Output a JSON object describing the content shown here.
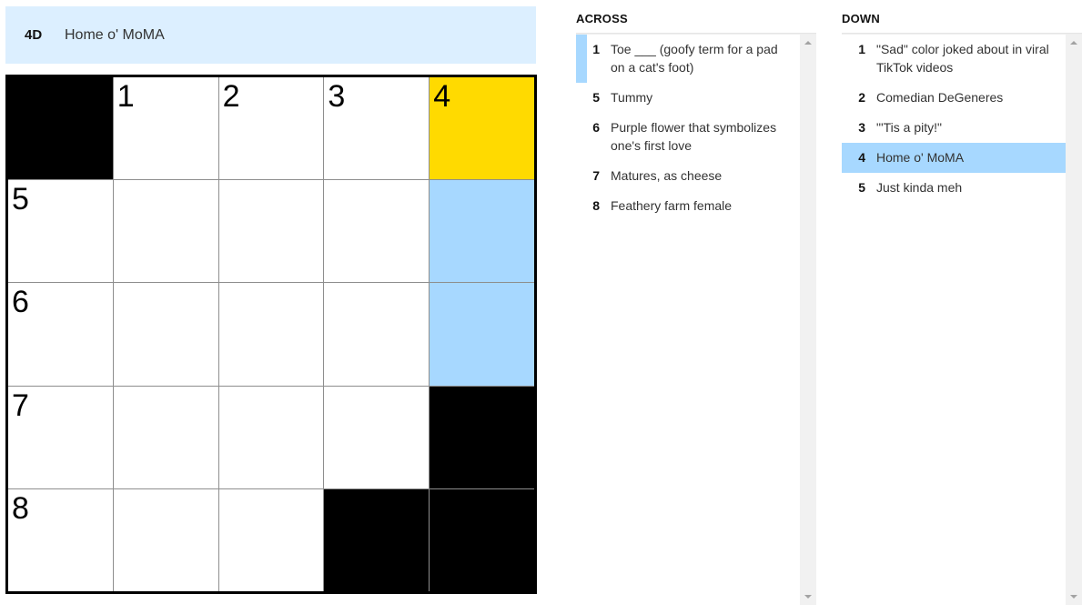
{
  "current_clue": {
    "label": "4D",
    "text": "Home o' MoMA"
  },
  "board": {
    "rows": [
      [
        {
          "type": "block"
        },
        {
          "num": "1"
        },
        {
          "num": "2"
        },
        {
          "num": "3"
        },
        {
          "num": "4",
          "state": "selected"
        }
      ],
      [
        {
          "num": "5"
        },
        {},
        {},
        {},
        {
          "state": "highlight"
        }
      ],
      [
        {
          "num": "6"
        },
        {},
        {},
        {},
        {
          "state": "highlight"
        }
      ],
      [
        {
          "num": "7"
        },
        {},
        {},
        {},
        {
          "type": "block"
        }
      ],
      [
        {
          "num": "8"
        },
        {},
        {},
        {
          "type": "block"
        },
        {
          "type": "block"
        }
      ]
    ]
  },
  "across": {
    "title": "ACROSS",
    "items": [
      {
        "num": "1",
        "text": "Toe ___ (goofy term for a pad on a cat's foot)",
        "state": "cross-active"
      },
      {
        "num": "5",
        "text": "Tummy"
      },
      {
        "num": "6",
        "text": "Purple flower that symbolizes one's first love"
      },
      {
        "num": "7",
        "text": "Matures, as cheese"
      },
      {
        "num": "8",
        "text": "Feathery farm female"
      }
    ]
  },
  "down": {
    "title": "DOWN",
    "items": [
      {
        "num": "1",
        "text": "\"Sad\" color joked about in viral TikTok videos"
      },
      {
        "num": "2",
        "text": "Comedian DeGeneres"
      },
      {
        "num": "3",
        "text": "\"'Tis a pity!\""
      },
      {
        "num": "4",
        "text": "Home o' MoMA",
        "state": "active"
      },
      {
        "num": "5",
        "text": "Just kinda meh"
      }
    ]
  },
  "colors": {
    "selected_cell": "#ffda00",
    "highlight_cell": "#a7d8ff",
    "clue_bar": "#dcefff",
    "block": "#000000"
  }
}
